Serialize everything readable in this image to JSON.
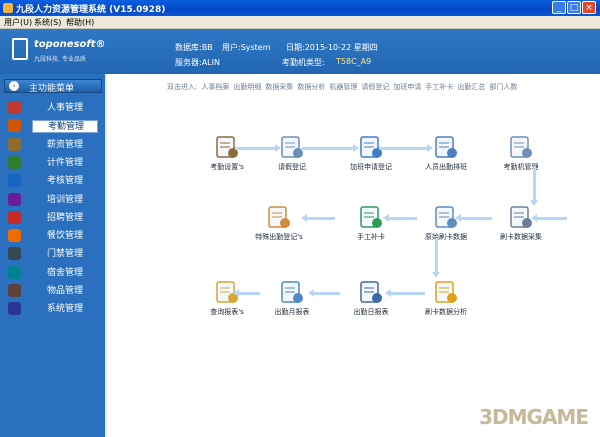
{
  "window": {
    "title": "九段人力资源管理系统 (V15.0928)",
    "min": "_",
    "max": "□",
    "close": "×"
  },
  "menubar": [
    "用户(U)",
    "系统(S)",
    "帮助(H)"
  ],
  "header": {
    "logo_name": "toponesoft®",
    "logo_slogan": "九段科技, 专业品质",
    "database_label": "数据库:BB",
    "user_label": "用户:System",
    "date_label": "日期:2015-10-22 星期四",
    "server_label": "服务器:ALIN",
    "machine_type_label": "考勤机类型:",
    "machine_type_value": "T58C_A9"
  },
  "sidebar": {
    "title": "主功能菜单",
    "items": [
      {
        "label": "人事管理",
        "color": "#c0392b"
      },
      {
        "label": "考勤管理",
        "color": "#d35400"
      },
      {
        "label": "薪资管理",
        "color": "#8e6b2f"
      },
      {
        "label": "计件管理",
        "color": "#2e7d32"
      },
      {
        "label": "考核管理",
        "color": "#1565c0"
      },
      {
        "label": "培训管理",
        "color": "#6a1b9a"
      },
      {
        "label": "招聘管理",
        "color": "#c62828"
      },
      {
        "label": "餐饮管理",
        "color": "#ef6c00"
      },
      {
        "label": "门禁管理",
        "color": "#37474f"
      },
      {
        "label": "宿舍管理",
        "color": "#00838f"
      },
      {
        "label": "物品管理",
        "color": "#5d4037"
      },
      {
        "label": "系统管理",
        "color": "#283593"
      }
    ],
    "active_index": 1
  },
  "quickbar": {
    "prefix": "双击进入:",
    "links": [
      "人事档案",
      "出勤明细",
      "数据采集",
      "数据分析",
      "机器管理",
      "请假登记",
      "加班申请",
      "手工补卡",
      "出勤汇总",
      "部门人数"
    ]
  },
  "flow": [
    {
      "label": "考勤设置's",
      "icon": "settings-icon",
      "color": "#8b6a3e"
    },
    {
      "label": "请假登记",
      "icon": "leave-register-icon",
      "color": "#6c8fb6"
    },
    {
      "label": "加班申请登记",
      "icon": "overtime-icon",
      "color": "#3f7fc9"
    },
    {
      "label": "人员出勤排班",
      "icon": "clock-icon",
      "color": "#4a7fc0"
    },
    {
      "label": "考勤机管理",
      "icon": "calculator-icon",
      "color": "#6f8fb4"
    },
    {
      "label": "特殊出勤登记's",
      "icon": "pencil-doc-icon",
      "color": "#d08a3a"
    },
    {
      "label": "手工补卡",
      "icon": "manual-card-icon",
      "color": "#2f9a5a"
    },
    {
      "label": "原始刷卡数据",
      "icon": "raw-data-icon",
      "color": "#5b8cc2"
    },
    {
      "label": "刷卡数据采集",
      "icon": "satellite-icon",
      "color": "#6b7f99"
    },
    {
      "label": "查询报表's",
      "icon": "folder-search-icon",
      "color": "#d9a531"
    },
    {
      "label": "出勤月报表",
      "icon": "monthly-report-icon",
      "color": "#4f88c4"
    },
    {
      "label": "出勤日报表",
      "icon": "daily-report-icon",
      "color": "#3c6aa8"
    },
    {
      "label": "刷卡数据分析",
      "icon": "gears-icon",
      "color": "#e0a11a"
    }
  ],
  "watermark": "3DMGAME"
}
